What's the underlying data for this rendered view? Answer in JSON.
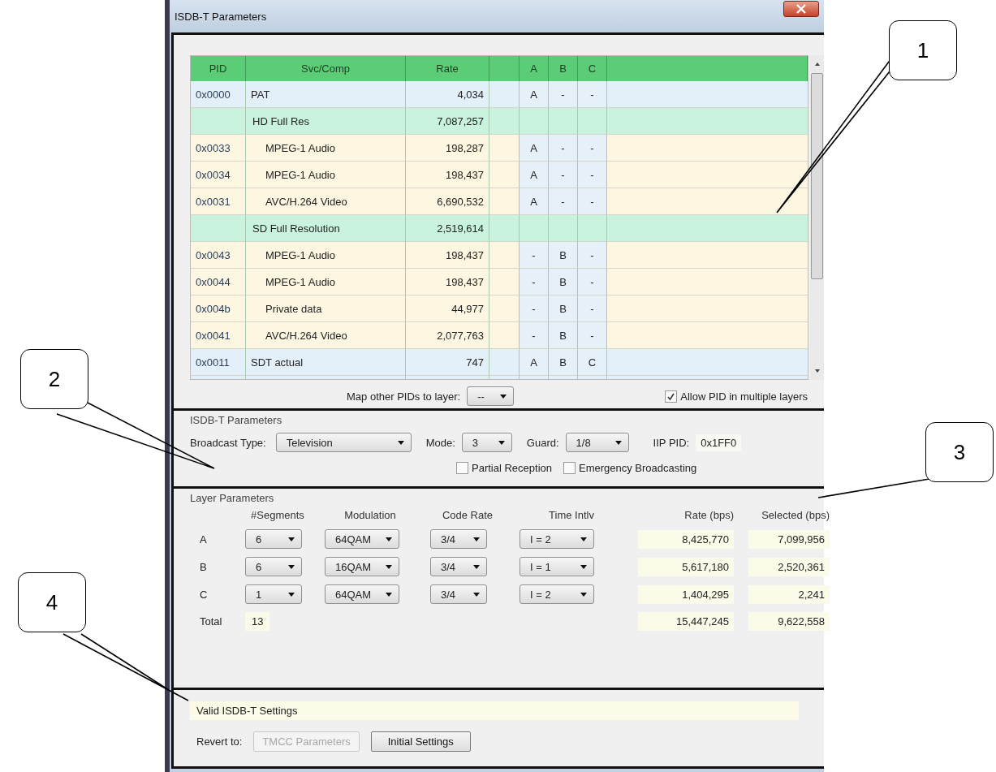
{
  "window": {
    "title": "ISDB-T Parameters"
  },
  "pid_table": {
    "columns": [
      "PID",
      "Svc/Comp",
      "Rate",
      "A",
      "B",
      "C"
    ],
    "rows": [
      {
        "kind": "table",
        "pid": "0x0000",
        "name": "PAT",
        "rate": "4,034",
        "a": "A",
        "b": "-",
        "c": "-"
      },
      {
        "kind": "service",
        "name": "HD Full Res",
        "rate": "7,087,257"
      },
      {
        "kind": "component",
        "pid": "0x0033",
        "name": "MPEG-1 Audio",
        "rate": "198,287",
        "a": "A",
        "b": "-",
        "c": "-"
      },
      {
        "kind": "component",
        "pid": "0x0034",
        "name": "MPEG-1 Audio",
        "rate": "198,437",
        "a": "A",
        "b": "-",
        "c": "-"
      },
      {
        "kind": "component",
        "pid": "0x0031",
        "name": "AVC/H.264 Video",
        "rate": "6,690,532",
        "a": "A",
        "b": "-",
        "c": "-"
      },
      {
        "kind": "service",
        "name": "SD Full Resolution",
        "rate": "2,519,614"
      },
      {
        "kind": "component",
        "pid": "0x0043",
        "name": "MPEG-1 Audio",
        "rate": "198,437",
        "a": "-",
        "b": "B",
        "c": "-"
      },
      {
        "kind": "component",
        "pid": "0x0044",
        "name": "MPEG-1 Audio",
        "rate": "198,437",
        "a": "-",
        "b": "B",
        "c": "-"
      },
      {
        "kind": "component",
        "pid": "0x004b",
        "name": "Private data",
        "rate": "44,977",
        "a": "-",
        "b": "B",
        "c": "-"
      },
      {
        "kind": "component",
        "pid": "0x0041",
        "name": "AVC/H.264 Video",
        "rate": "2,077,763",
        "a": "-",
        "b": "B",
        "c": "-"
      },
      {
        "kind": "table",
        "pid": "0x0011",
        "name": "SDT actual",
        "rate": "747",
        "a": "A",
        "b": "B",
        "c": "C"
      }
    ]
  },
  "map_other": {
    "label": "Map other PIDs to layer:",
    "value": "--"
  },
  "allow_multiple": {
    "label": "Allow PID in multiple layers",
    "checked": true
  },
  "isdbt_params": {
    "title": "ISDB-T Parameters",
    "broadcast_type": {
      "label": "Broadcast Type:",
      "value": "Television"
    },
    "mode": {
      "label": "Mode:",
      "value": "3"
    },
    "guard": {
      "label": "Guard:",
      "value": "1/8"
    },
    "iip_pid": {
      "label": "IIP PID:",
      "value": "0x1FF0"
    },
    "partial_reception": {
      "label": "Partial Reception",
      "checked": false
    },
    "emergency": {
      "label": "Emergency Broadcasting",
      "checked": false
    }
  },
  "layer_params": {
    "title": "Layer Parameters",
    "columns": [
      "#Segments",
      "Modulation",
      "Code Rate",
      "Time Intlv",
      "Rate (bps)",
      "Selected (bps)"
    ],
    "rows": [
      {
        "layer": "A",
        "segments": "6",
        "modulation": "64QAM",
        "code_rate": "3/4",
        "time_intlv": "I = 2",
        "rate": "8,425,770",
        "selected": "7,099,956"
      },
      {
        "layer": "B",
        "segments": "6",
        "modulation": "16QAM",
        "code_rate": "3/4",
        "time_intlv": "I = 1",
        "rate": "5,617,180",
        "selected": "2,520,361"
      },
      {
        "layer": "C",
        "segments": "1",
        "modulation": "64QAM",
        "code_rate": "3/4",
        "time_intlv": "I = 2",
        "rate": "1,404,295",
        "selected": "2,241"
      }
    ],
    "total": {
      "label": "Total",
      "segments": "13",
      "rate": "15,447,245",
      "selected": "9,622,558"
    }
  },
  "status": {
    "message": "Valid ISDB-T Settings",
    "revert_label": "Revert to:",
    "buttons": [
      {
        "label": "TMCC Parameters",
        "disabled": true
      },
      {
        "label": "Initial Settings",
        "disabled": false
      }
    ]
  },
  "callouts": [
    "1",
    "2",
    "3",
    "4"
  ]
}
